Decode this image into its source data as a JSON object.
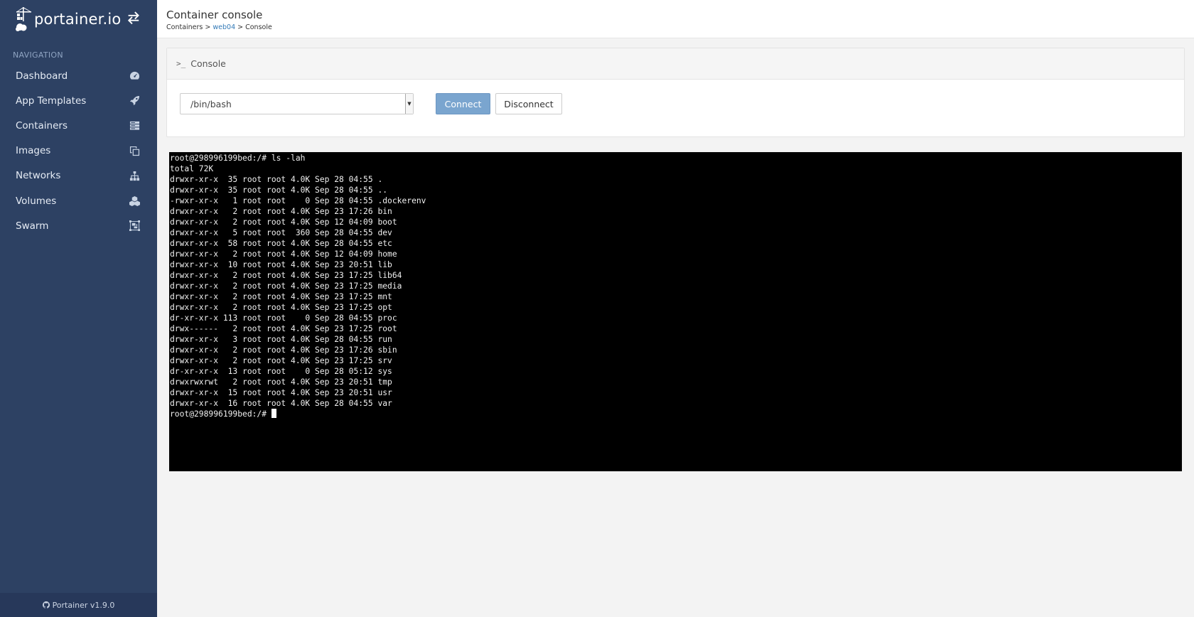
{
  "brand": {
    "name": "portainer.io"
  },
  "sidebar": {
    "nav_title": "NAVIGATION",
    "items": [
      {
        "label": "Dashboard",
        "icon": "tachometer-icon"
      },
      {
        "label": "App Templates",
        "icon": "rocket-icon"
      },
      {
        "label": "Containers",
        "icon": "server-icon"
      },
      {
        "label": "Images",
        "icon": "clone-icon"
      },
      {
        "label": "Networks",
        "icon": "sitemap-icon"
      },
      {
        "label": "Volumes",
        "icon": "cubes-icon"
      },
      {
        "label": "Swarm",
        "icon": "object-group-icon"
      }
    ],
    "footer": "Portainer v1.9.0"
  },
  "header": {
    "title": "Container console",
    "breadcrumb": {
      "root": "Containers",
      "sep1": " > ",
      "container": "web04",
      "sep2": " > ",
      "current": "Console"
    }
  },
  "console": {
    "widget_title": "Console",
    "shell_value": "/bin/bash",
    "connect_label": "Connect",
    "disconnect_label": "Disconnect"
  },
  "terminal": {
    "lines": [
      "root@298996199bed:/# ls -lah",
      "total 72K",
      "drwxr-xr-x  35 root root 4.0K Sep 28 04:55 .",
      "drwxr-xr-x  35 root root 4.0K Sep 28 04:55 ..",
      "-rwxr-xr-x   1 root root    0 Sep 28 04:55 .dockerenv",
      "drwxr-xr-x   2 root root 4.0K Sep 23 17:26 bin",
      "drwxr-xr-x   2 root root 4.0K Sep 12 04:09 boot",
      "drwxr-xr-x   5 root root  360 Sep 28 04:55 dev",
      "drwxr-xr-x  58 root root 4.0K Sep 28 04:55 etc",
      "drwxr-xr-x   2 root root 4.0K Sep 12 04:09 home",
      "drwxr-xr-x  10 root root 4.0K Sep 23 20:51 lib",
      "drwxr-xr-x   2 root root 4.0K Sep 23 17:25 lib64",
      "drwxr-xr-x   2 root root 4.0K Sep 23 17:25 media",
      "drwxr-xr-x   2 root root 4.0K Sep 23 17:25 mnt",
      "drwxr-xr-x   2 root root 4.0K Sep 23 17:25 opt",
      "dr-xr-xr-x 113 root root    0 Sep 28 04:55 proc",
      "drwx------   2 root root 4.0K Sep 23 17:25 root",
      "drwxr-xr-x   3 root root 4.0K Sep 28 04:55 run",
      "drwxr-xr-x   2 root root 4.0K Sep 23 17:26 sbin",
      "drwxr-xr-x   2 root root 4.0K Sep 23 17:25 srv",
      "dr-xr-xr-x  13 root root    0 Sep 28 05:12 sys",
      "drwxrwxrwt   2 root root 4.0K Sep 23 20:51 tmp",
      "drwxr-xr-x  15 root root 4.0K Sep 23 20:51 usr",
      "drwxr-xr-x  16 root root 4.0K Sep 28 04:55 var"
    ],
    "prompt": "root@298996199bed:/# "
  }
}
